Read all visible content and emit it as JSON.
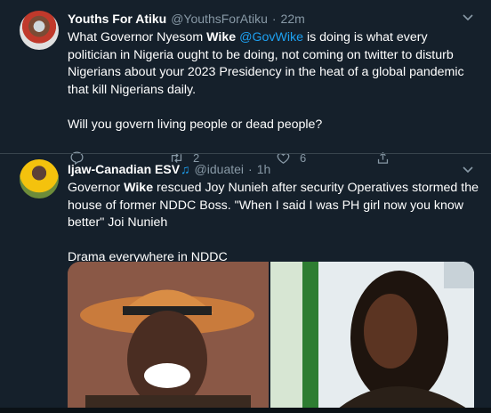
{
  "tweets": [
    {
      "name": "Youths For Atiku",
      "handle": "@YouthsForAtiku",
      "dot": "·",
      "time": "22m",
      "text_parts": {
        "p1": "What Governor Nyesom ",
        "bold1": "Wike",
        "p2": " ",
        "mention": "@GovWike",
        "p3": " is doing is what every politician in Nigeria ought to be doing, not coming on twitter to disturb Nigerians about your 2023 Presidency in the heat of a global pandemic that kill Nigerians daily.",
        "p4": "Will you govern living people or dead people?"
      },
      "retweets": "2",
      "likes": "6"
    },
    {
      "name": "Ijaw-Canadian ESV",
      "name_icon": "♫",
      "handle": "@iduatei",
      "dot": "·",
      "time": "1h",
      "text_parts": {
        "p1": "Governor ",
        "bold1": "Wike",
        "p2": " rescued Joy Nunieh after security Operatives stormed the house of former NDDC Boss. \"When I said I was PH girl now you know better\"  Joi Nunieh",
        "p3": "Drama everywhere in NDDC"
      }
    }
  ],
  "icons": {
    "reply": "reply-icon",
    "retweet": "retweet-icon",
    "like": "heart-icon",
    "share": "share-icon",
    "more": "chevron-down-icon"
  },
  "colors": {
    "background": "#15202b",
    "accent": "#1da1f2",
    "muted": "#8899a6",
    "divider": "#38444d"
  }
}
